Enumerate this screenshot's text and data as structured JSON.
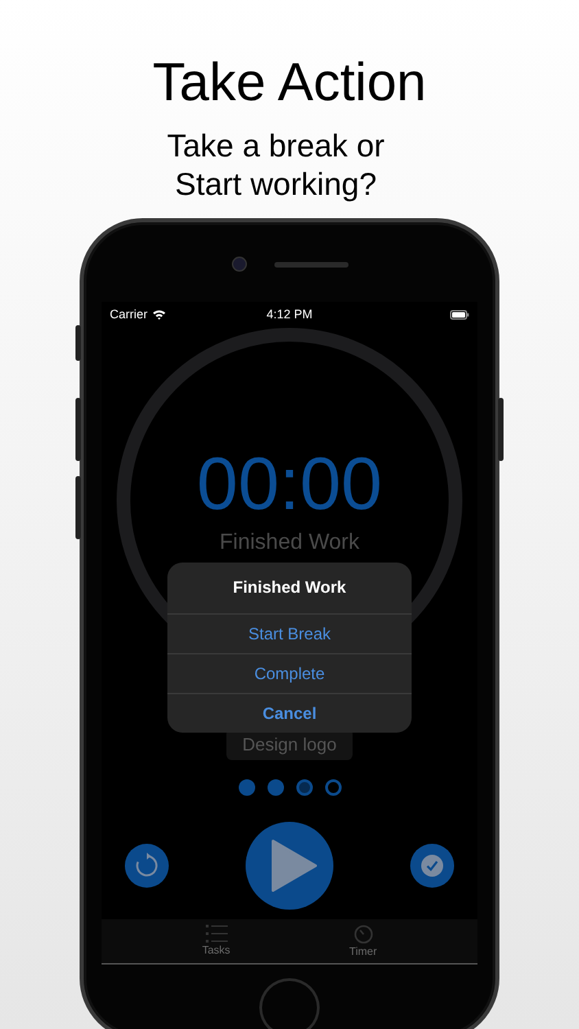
{
  "headline": "Take Action",
  "subtitle_lines": [
    "Take a break or",
    "Start working?"
  ],
  "status_bar": {
    "carrier": "Carrier",
    "time": "4:12 PM"
  },
  "timer": {
    "time": "00:00",
    "label": "Finished Work"
  },
  "alert": {
    "title": "Finished Work",
    "actions": [
      {
        "label": "Start Break",
        "kind": "default"
      },
      {
        "label": "Complete",
        "kind": "default"
      },
      {
        "label": "Cancel",
        "kind": "cancel"
      }
    ]
  },
  "current_task": "Design logo",
  "sessions": [
    {
      "kind": "done"
    },
    {
      "kind": "done"
    },
    {
      "kind": "current"
    },
    {
      "kind": "pending"
    }
  ],
  "tab_bar": [
    {
      "label": "Tasks",
      "kind": "list"
    },
    {
      "label": "Timer",
      "kind": "timer"
    }
  ]
}
